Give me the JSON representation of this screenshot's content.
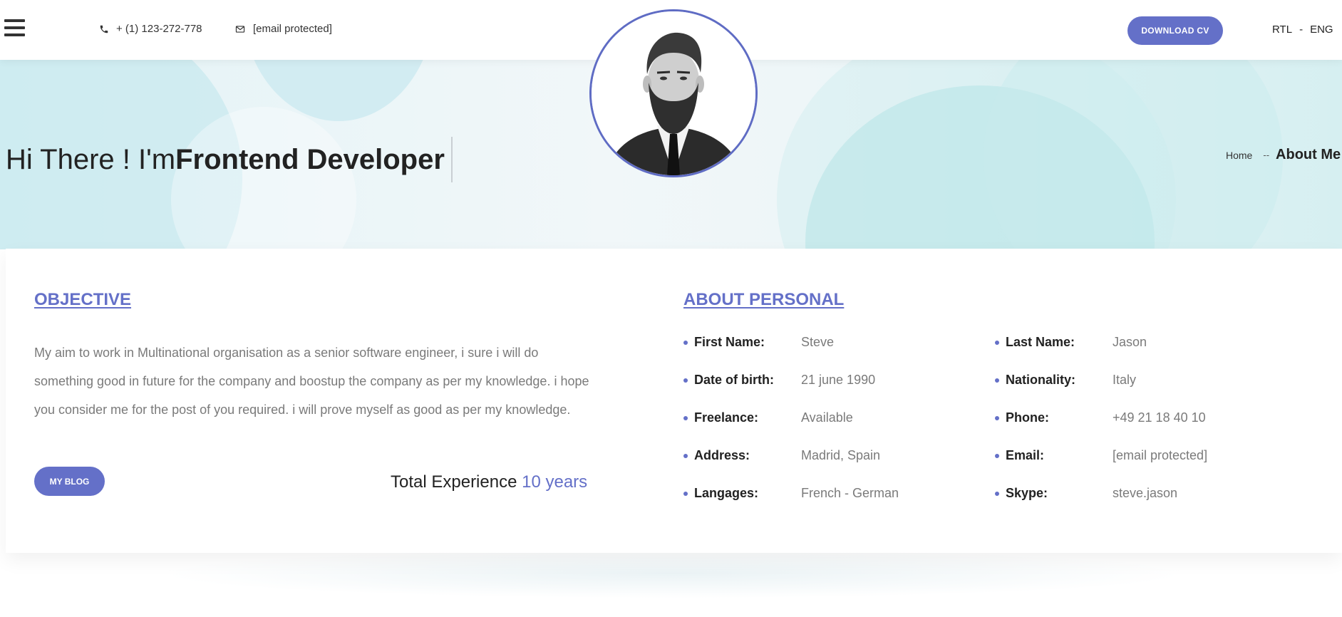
{
  "header": {
    "phone": "+ (1) 123-272-778",
    "email": "[email protected]",
    "download_label": "DOWNLOAD CV",
    "lang_rtl": "RTL",
    "lang_sep": "-",
    "lang_eng": "ENG"
  },
  "hero": {
    "greeting": "Hi There ! I'm",
    "role": "Frontend Developer",
    "breadcrumb_home": "Home",
    "breadcrumb_sep": "--",
    "breadcrumb_current": "About Me"
  },
  "objective": {
    "title": "OBJECTIVE",
    "text": "My aim to work in Multinational organisation as a senior software engineer, i sure i will do something good in future for the company and boostup the company as per my knowledge. i hope you consider me for the post of you required. i will prove myself as good as per my knowledge.",
    "blog_label": "MY BLOG",
    "experience_label": "Total Experience",
    "experience_value": "10 years"
  },
  "about": {
    "title": "ABOUT PERSONAL",
    "left": [
      {
        "label": "First Name:",
        "value": "Steve"
      },
      {
        "label": "Date of birth:",
        "value": "21 june 1990"
      },
      {
        "label": "Freelance:",
        "value": "Available"
      },
      {
        "label": "Address:",
        "value": "Madrid, Spain"
      },
      {
        "label": "Langages:",
        "value": "French - German"
      }
    ],
    "right": [
      {
        "label": "Last Name:",
        "value": "Jason"
      },
      {
        "label": "Nationality:",
        "value": "Italy"
      },
      {
        "label": "Phone:",
        "value": "+49 21 18 40 10"
      },
      {
        "label": "Email:",
        "value": "[email protected]"
      },
      {
        "label": "Skype:",
        "value": "steve.jason"
      }
    ]
  },
  "colors": {
    "accent": "#6470c8",
    "hero_bg": "#e3f3f6",
    "muted_text": "#7a7a7a"
  },
  "icons": {
    "menu": "hamburger-menu-icon",
    "phone": "phone-icon",
    "email": "envelope-icon",
    "avatar": "profile-photo"
  }
}
